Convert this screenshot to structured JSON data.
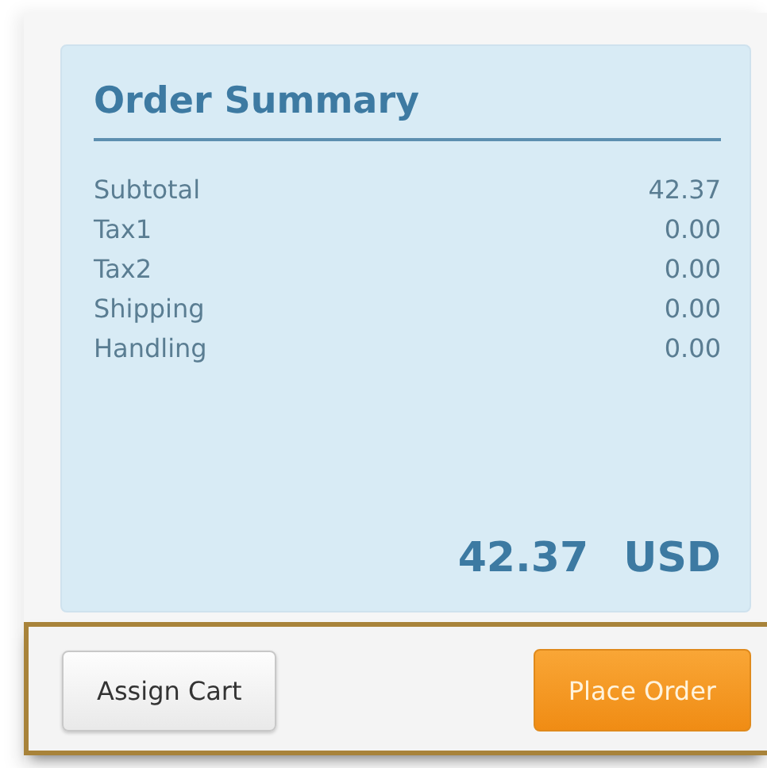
{
  "order_summary": {
    "title": "Order Summary",
    "lines": [
      {
        "label": "Subtotal",
        "amount": "42.37"
      },
      {
        "label": "Tax1",
        "amount": "0.00"
      },
      {
        "label": "Tax2",
        "amount": "0.00"
      },
      {
        "label": "Shipping",
        "amount": "0.00"
      },
      {
        "label": "Handling",
        "amount": "0.00"
      }
    ],
    "total": {
      "amount": "42.37",
      "currency": "USD"
    }
  },
  "actions": [
    {
      "label": "Assign Cart",
      "kind": "secondary"
    },
    {
      "label": "Place Order",
      "kind": "primary"
    }
  ]
}
